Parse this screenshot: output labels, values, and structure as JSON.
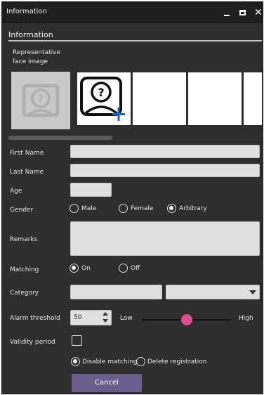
{
  "window": {
    "title": "Information",
    "controls": {
      "minimize_icon": "minimize-icon",
      "maximize_icon": "maximize-icon",
      "close_icon": "close-icon"
    }
  },
  "section": {
    "title": "Information"
  },
  "face": {
    "label_line1": "Representative",
    "label_line2": "face image",
    "add_icon": "add-face-icon"
  },
  "form": {
    "first_name": {
      "label": "First Name",
      "value": ""
    },
    "last_name": {
      "label": "Last Name",
      "value": ""
    },
    "age": {
      "label": "Age",
      "value": ""
    },
    "gender": {
      "label": "Gender",
      "options": [
        "Male",
        "Female",
        "Arbitrary"
      ],
      "selected": "Arbitrary"
    },
    "remarks": {
      "label": "Remarks",
      "value": ""
    },
    "matching": {
      "label": "Matching",
      "options": [
        "On",
        "Off"
      ],
      "selected": "On"
    },
    "category": {
      "label": "Category",
      "value": "",
      "dropdown_value": ""
    },
    "alarm_threshold": {
      "label": "Alarm threshold",
      "value": "50",
      "low_label": "Low",
      "high_label": "High",
      "slider_level": 0.5
    },
    "validity_period": {
      "label": "Validity period",
      "checked": false,
      "options": [
        "Disable matching",
        "Delete registration"
      ],
      "selected": "Disable matching"
    }
  },
  "buttons": {
    "cancel": "Cancel"
  },
  "colors": {
    "window_bg": "#2e2e2e",
    "titlebar_bg": "#1f1f1f",
    "button_bg": "#6b5d8c",
    "slider_thumb": "#e04c8d",
    "add_plus": "#1f5fcf"
  }
}
